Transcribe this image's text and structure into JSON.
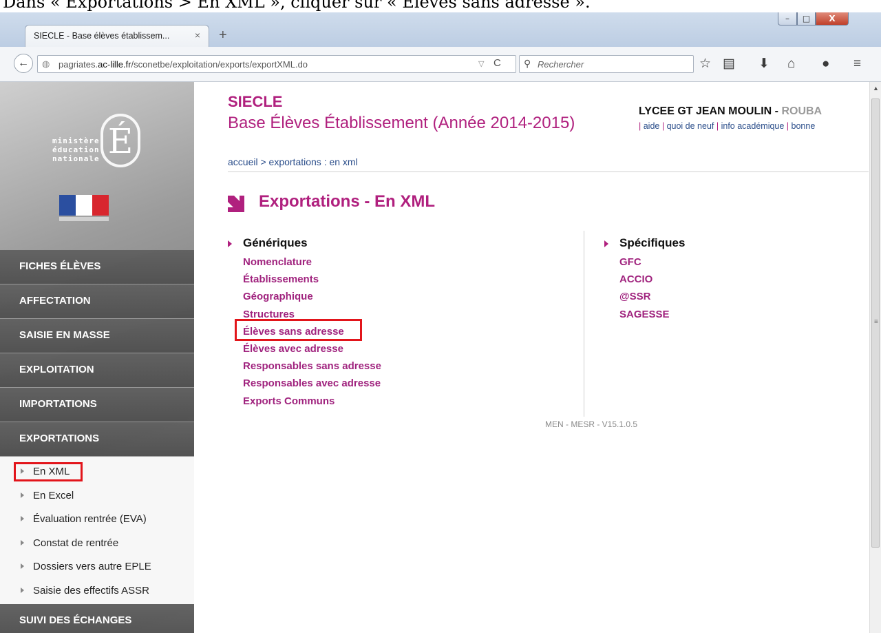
{
  "caption": "Dans « Exportations > En XML », cliquer sur « Élèves sans adresse ».",
  "window": {
    "tab_title": "SIECLE - Base élèves établissem...",
    "tab_close": "×",
    "new_tab": "+",
    "minimize": "–",
    "maximize": "□",
    "close": "X"
  },
  "nav": {
    "back": "←",
    "url_host_prefix": "pagriates.",
    "url_host_main": "ac-lille.fr",
    "url_path": "/sconetbe/exploitation/exports/exportXML.do",
    "url_dropdown": "▽",
    "reload": "C",
    "search_placeholder": "Rechercher",
    "icons": [
      "star-icon",
      "reading-list-icon",
      "download-icon",
      "home-icon",
      "chat-icon",
      "menu-icon"
    ]
  },
  "sidebar": {
    "logo_text": "ministère éducation nationale",
    "logo_line1": "ministère",
    "logo_line2": "éducation",
    "logo_line3": "nationale",
    "logo_letter": "É",
    "menu": [
      {
        "label": "FICHES ÉLÈVES"
      },
      {
        "label": "AFFECTATION"
      },
      {
        "label": "SAISIE EN MASSE"
      },
      {
        "label": "EXPLOITATION"
      },
      {
        "label": "IMPORTATIONS"
      },
      {
        "label": "EXPORTATIONS"
      }
    ],
    "submenu": [
      {
        "label": "En XML",
        "active": true
      },
      {
        "label": "En Excel"
      },
      {
        "label": "Évaluation rentrée (EVA)"
      },
      {
        "label": "Constat de rentrée"
      },
      {
        "label": "Dossiers vers autre EPLE"
      },
      {
        "label": "Saisie des effectifs ASSR"
      }
    ],
    "last_menu": "SUIVI DES ÉCHANGES"
  },
  "header": {
    "app_name": "SIECLE",
    "subtitle": "Base Élèves Établissement (Année 2014-2015)",
    "school": "LYCEE GT JEAN MOULIN",
    "school_sep": " - ",
    "city": "ROUBA",
    "links": [
      "aide",
      "quoi de neuf",
      "info académique",
      "bonne"
    ]
  },
  "breadcrumb": "accueil > exportations : en xml",
  "page_title": "Exportations - En XML",
  "generiques": {
    "title": "Génériques",
    "links": [
      "Nomenclature",
      "Établissements",
      "Géographique",
      "Structures",
      "Élèves sans adresse",
      "Élèves avec adresse",
      "Responsables sans adresse",
      "Responsables avec adresse",
      "Exports Communs"
    ]
  },
  "specifiques": {
    "title": "Spécifiques",
    "links": [
      "GFC",
      "ACCIO",
      "@SSR",
      "SAGESSE"
    ]
  },
  "version": "MEN - MESR - V15.1.0.5",
  "colors": {
    "accent": "#b0207e",
    "link": "#2a4d8a",
    "highlight": "#e2151b",
    "menu_bg": "#555555"
  }
}
